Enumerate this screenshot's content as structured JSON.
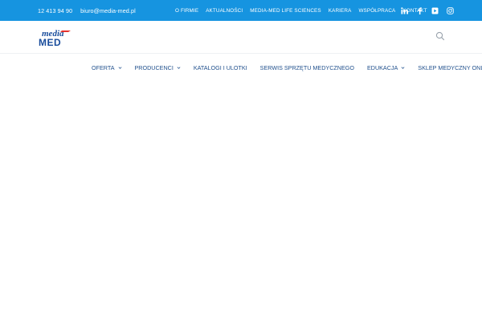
{
  "topbar": {
    "phone": "12 413 94 90",
    "email": "biuro@media-med.pl",
    "links": [
      "O FIRMIE",
      "AKTUALNOŚCI",
      "MEDIA-MED LIFE SCIENCES",
      "KARIERA",
      "WSPÓŁPRACA",
      "KONTAKT"
    ],
    "social_icons": [
      "linkedin-icon",
      "facebook-icon",
      "youtube-icon",
      "instagram-icon"
    ]
  },
  "header": {
    "logo": {
      "line1": "media",
      "line2": "MED"
    },
    "search_icon": "search-icon"
  },
  "nav": {
    "items": [
      {
        "label": "OFERTA",
        "has_dropdown": true
      },
      {
        "label": "PRODUCENCI",
        "has_dropdown": true
      },
      {
        "label": "KATALOGI I ULOTKI",
        "has_dropdown": false
      },
      {
        "label": "SERWIS SPRZĘTU MEDYCZNEGO",
        "has_dropdown": false
      },
      {
        "label": "EDUKACJA",
        "has_dropdown": true
      },
      {
        "label": "SKLEP MEDYCZNY ONLINE",
        "has_dropdown": false
      }
    ]
  },
  "colors": {
    "topbar_bg": "#1694e0",
    "nav_text": "#1f4f8c",
    "logo_blue": "#1a4d9c",
    "logo_red": "#e5322d"
  }
}
